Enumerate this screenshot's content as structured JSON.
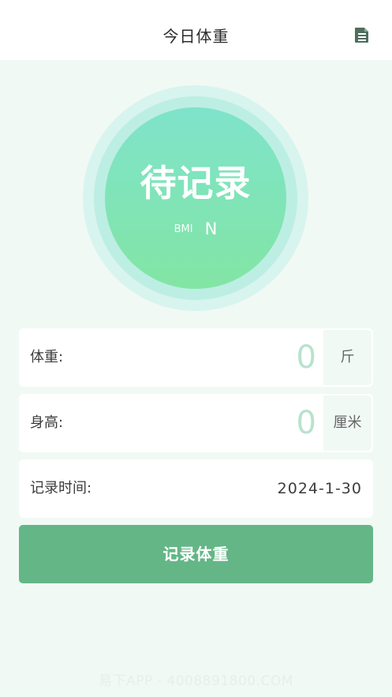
{
  "header": {
    "title": "今日体重",
    "doc_icon": "document-icon"
  },
  "status": {
    "title": "待记录",
    "bmi_label": "BMI",
    "bmi_value": "N"
  },
  "weight": {
    "label": "体重:",
    "value": "0",
    "unit": "斤"
  },
  "height": {
    "label": "身高:",
    "value": "0",
    "unit": "厘米"
  },
  "record_time": {
    "label": "记录时间:",
    "value": "2024-1-30"
  },
  "record_button": {
    "label": "记录体重"
  },
  "watermark": {
    "text": "易下APP · 4008891800.COM"
  },
  "colors": {
    "accent": "#64b687",
    "background": "#f1f9f5",
    "circle_top": "#7fe3cb",
    "circle_bottom": "#82e5a4",
    "input_value": "#b9e2cd"
  }
}
